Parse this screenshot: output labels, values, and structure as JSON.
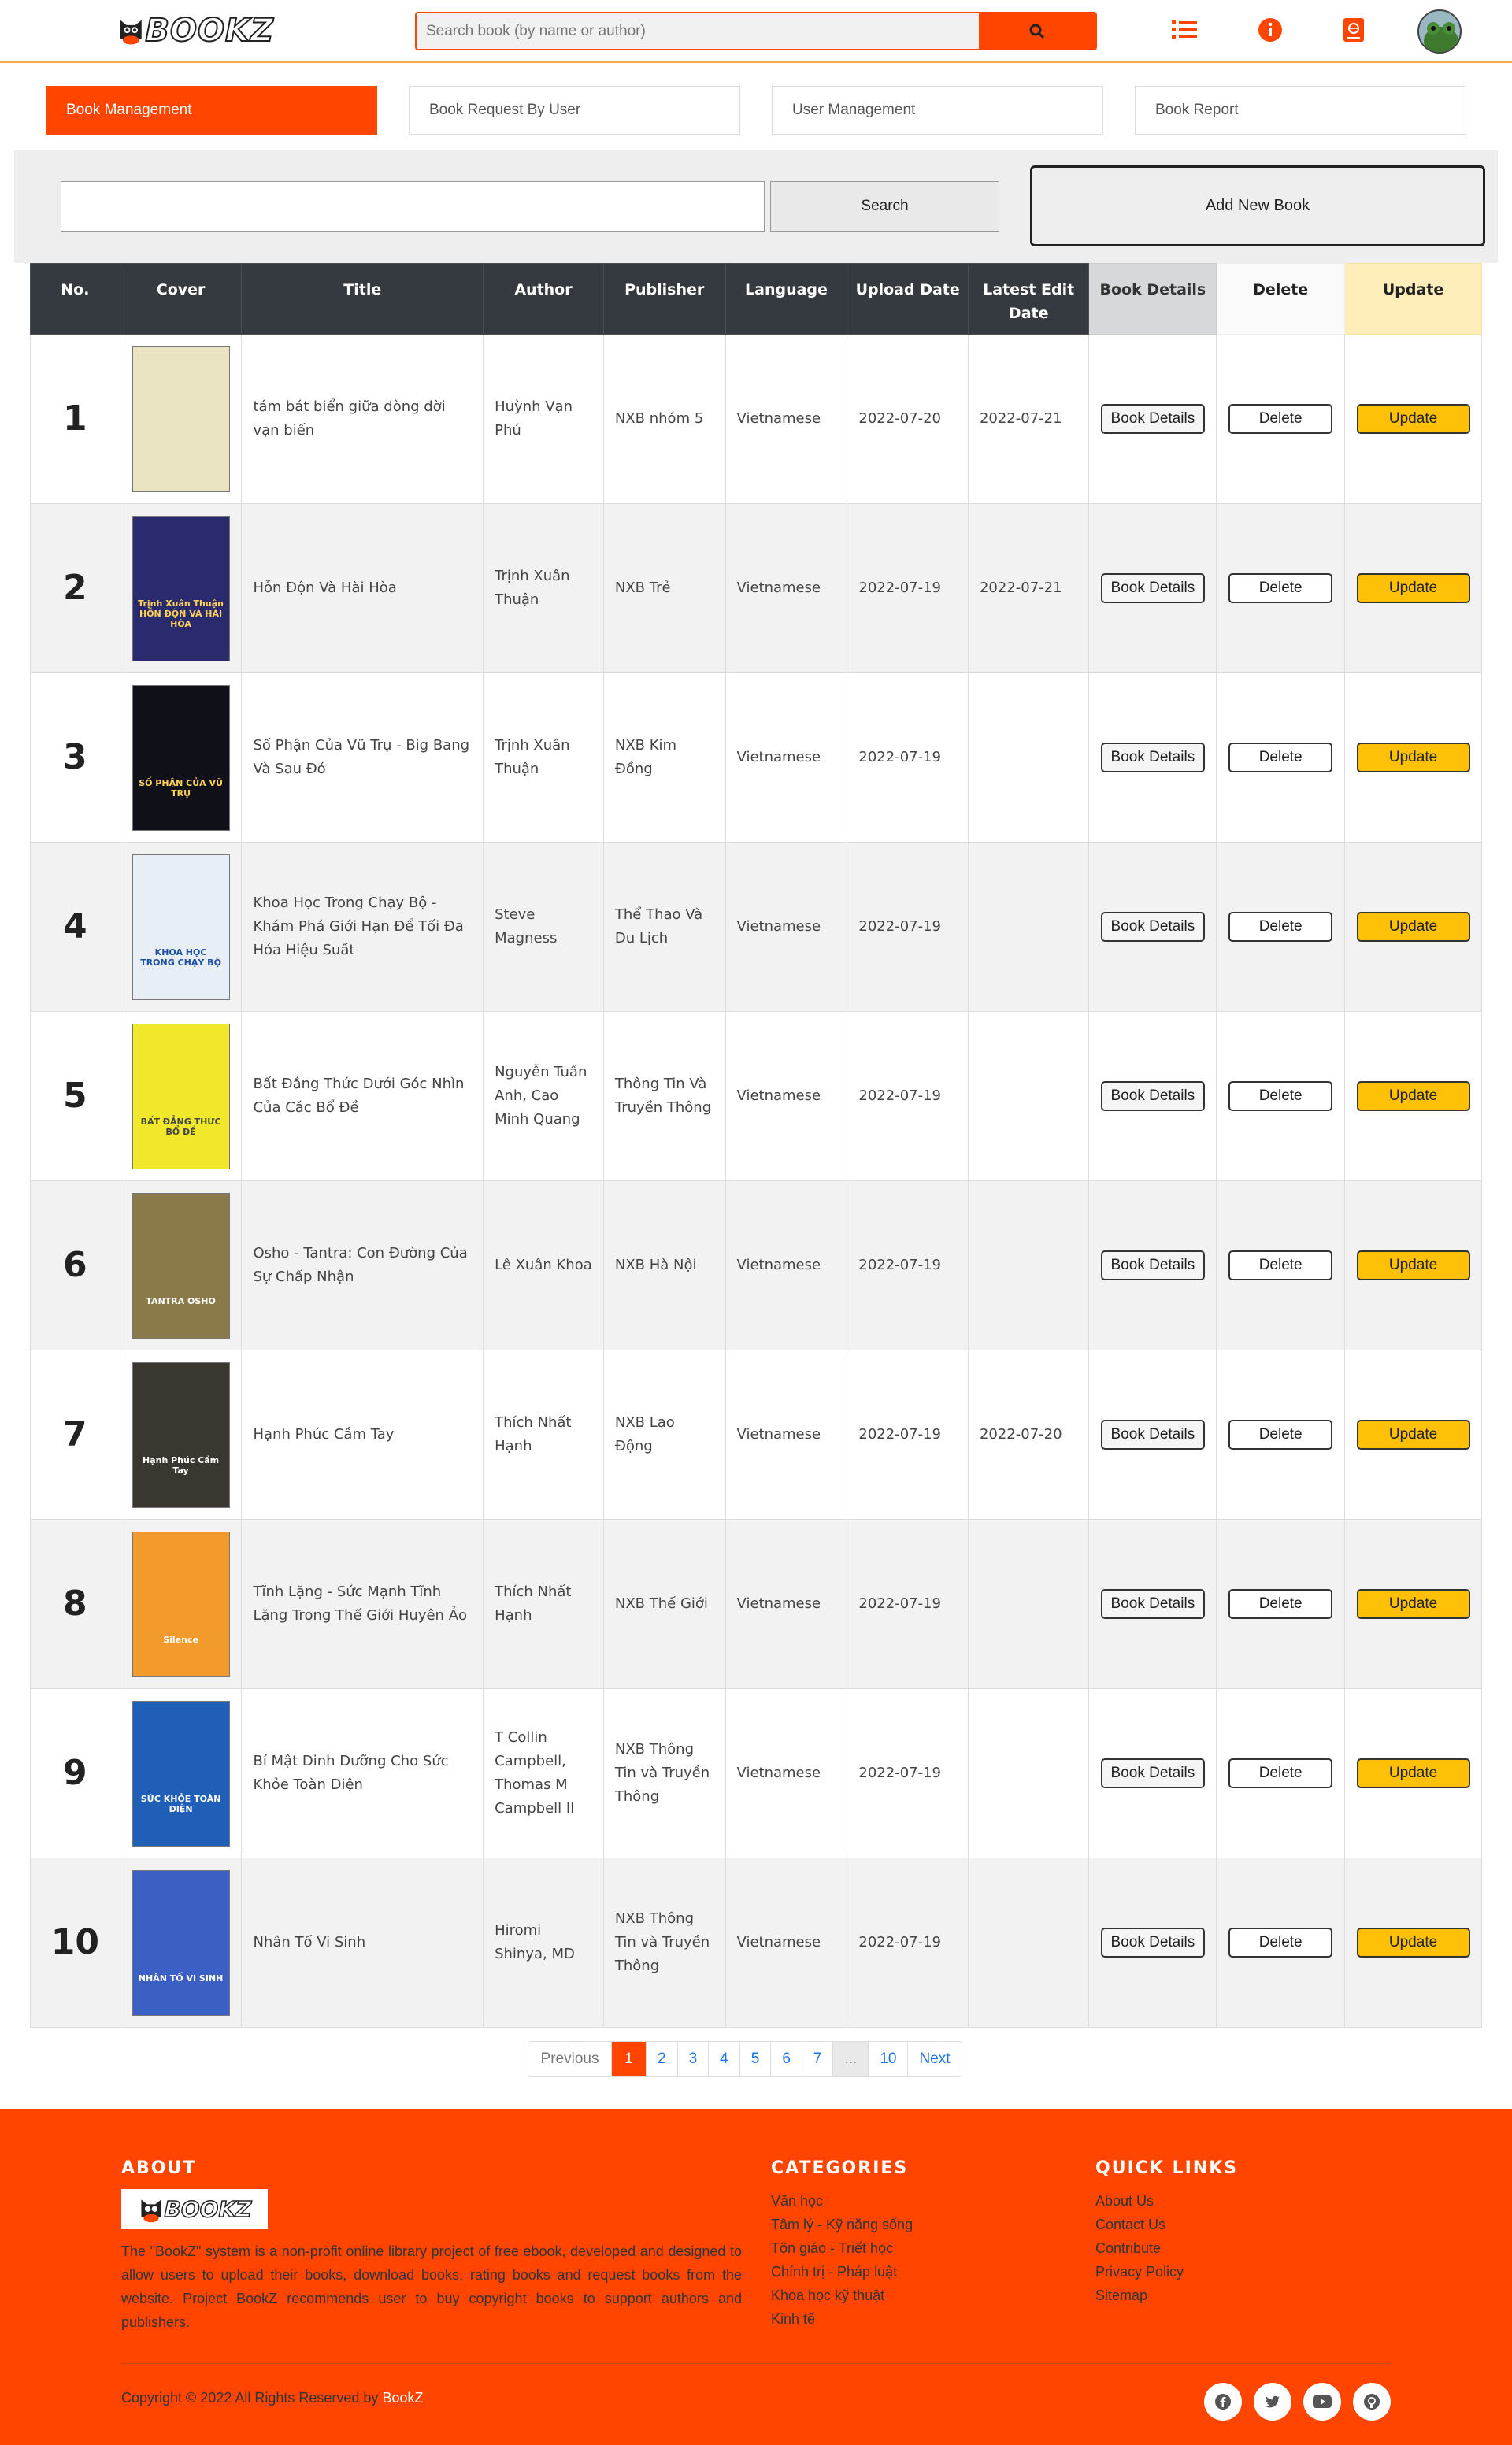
{
  "header": {
    "logo_text": "BOOKZ",
    "search_placeholder": "Search book (by name or author)",
    "icons": [
      "list-icon",
      "info-icon",
      "book-icon",
      "avatar"
    ]
  },
  "tabs": [
    {
      "label": "Book Management",
      "active": true
    },
    {
      "label": "Book Request By User",
      "active": false
    },
    {
      "label": "User Management",
      "active": false
    },
    {
      "label": "Book Report",
      "active": false
    }
  ],
  "toolbar": {
    "search_value": "",
    "search_label": "Search",
    "add_label": "Add New Book"
  },
  "table": {
    "headers": [
      "No.",
      "Cover",
      "Title",
      "Author",
      "Publisher",
      "Language",
      "Upload Date",
      "Latest Edit Date",
      "Book Details",
      "Delete",
      "Update"
    ],
    "button_labels": {
      "details": "Book Details",
      "delete": "Delete",
      "update": "Update"
    },
    "rows": [
      {
        "no": "1",
        "title": "tám bát biển giữa dòng đời vạn biến",
        "author": "Huỳnh Vạn Phú",
        "publisher": "NXB nhóm 5",
        "language": "Vietnamese",
        "upload": "2022-07-20",
        "edited": "2022-07-21",
        "cover_color": "#e9e3c2",
        "cover_text": "",
        "cover_text_color": "#333"
      },
      {
        "no": "2",
        "title": "Hỗn Độn Và Hài Hòa",
        "author": "Trịnh Xuân Thuận",
        "publisher": "NXB Trẻ",
        "language": "Vietnamese",
        "upload": "2022-07-19",
        "edited": "2022-07-21",
        "cover_color": "#2a2a6e",
        "cover_text": "Trịnh Xuân Thuận HỖN ĐỘN VÀ HÀI HÒA",
        "cover_text_color": "#ffd35a"
      },
      {
        "no": "3",
        "title": "Số Phận Của Vũ Trụ - Big Bang Và Sau Đó",
        "author": "Trịnh Xuân Thuận",
        "publisher": "NXB Kim Đồng",
        "language": "Vietnamese",
        "upload": "2022-07-19",
        "edited": "",
        "cover_color": "#101018",
        "cover_text": "SỐ PHẬN CỦA VŨ TRỤ",
        "cover_text_color": "#ffd35a"
      },
      {
        "no": "4",
        "title": "Khoa Học Trong Chạy Bộ - Khám Phá Giới Hạn Để Tối Đa Hóa Hiệu Suất",
        "author": "Steve Magness",
        "publisher": "Thể Thao Và Du Lịch",
        "language": "Vietnamese",
        "upload": "2022-07-19",
        "edited": "",
        "cover_color": "#e8eef5",
        "cover_text": "KHOA HỌC TRONG CHẠY BỘ",
        "cover_text_color": "#1d4fa0"
      },
      {
        "no": "5",
        "title": "Bất Đẳng Thức Dưới Góc Nhìn Của Các Bổ Đề",
        "author": "Nguyễn Tuấn Anh, Cao Minh Quang",
        "publisher": "Thông Tin Và Truyền Thông",
        "language": "Vietnamese",
        "upload": "2022-07-19",
        "edited": "",
        "cover_color": "#f2e82b",
        "cover_text": "BẤT ĐẲNG THỨC BỔ ĐỀ",
        "cover_text_color": "#444"
      },
      {
        "no": "6",
        "title": "Osho - Tantra: Con Đường Của Sự Chấp Nhận",
        "author": "Lê Xuân Khoa",
        "publisher": "NXB Hà Nội",
        "language": "Vietnamese",
        "upload": "2022-07-19",
        "edited": "",
        "cover_color": "#8a7a4a",
        "cover_text": "TANTRA OSHO",
        "cover_text_color": "#fff"
      },
      {
        "no": "7",
        "title": "Hạnh Phúc Cầm Tay",
        "author": "Thích Nhất Hạnh",
        "publisher": "NXB Lao Động",
        "language": "Vietnamese",
        "upload": "2022-07-19",
        "edited": "2022-07-20",
        "cover_color": "#3a3630",
        "cover_text": "Hạnh Phúc Cầm Tay",
        "cover_text_color": "#fff"
      },
      {
        "no": "8",
        "title": "Tĩnh Lặng - Sức Mạnh Tĩnh Lặng Trong Thế Giới Huyên Ảo",
        "author": "Thích Nhất Hạnh",
        "publisher": "NXB Thế Giới",
        "language": "Vietnamese",
        "upload": "2022-07-19",
        "edited": "",
        "cover_color": "#f39a2c",
        "cover_text": "Silence",
        "cover_text_color": "#fff"
      },
      {
        "no": "9",
        "title": "Bí Mật Dinh Dưỡng Cho Sức Khỏe Toàn Diện",
        "author": "T Collin Campbell, Thomas M Campbell II",
        "publisher": "NXB Thông Tin và Truyền Thông",
        "language": "Vietnamese",
        "upload": "2022-07-19",
        "edited": "",
        "cover_color": "#1f5fb8",
        "cover_text": "SỨC KHỎE TOÀN DIỆN",
        "cover_text_color": "#fff"
      },
      {
        "no": "10",
        "title": "Nhân Tố Vi Sinh",
        "author": "Hiromi Shinya, MD",
        "publisher": "NXB Thông Tin và Truyền Thông",
        "language": "Vietnamese",
        "upload": "2022-07-19",
        "edited": "",
        "cover_color": "#3b5fc4",
        "cover_text": "NHÂN TỐ VI SINH",
        "cover_text_color": "#fff"
      }
    ]
  },
  "pagination": {
    "prev": "Previous",
    "pages": [
      "1",
      "2",
      "3",
      "4",
      "5",
      "6",
      "7",
      "...",
      "10"
    ],
    "current": "1",
    "next": "Next"
  },
  "footer": {
    "about_title": "ABOUT",
    "about_text": "The \"BookZ\" system is a non-profit online library project of free ebook, developed and designed to allow users to upload their books, download books, rating books and request books from the website. Project BookZ recommends user to buy copyright books to support authors and publishers.",
    "categories_title": "CATEGORIES",
    "categories": [
      "Văn học",
      "Tâm lý - Kỹ năng sống",
      "Tôn giáo - Triết học",
      "Chính trị - Pháp luật",
      "Khoa học kỹ thuật",
      "Kinh tế"
    ],
    "quick_title": "QUICK LINKS",
    "quick_links": [
      "About Us",
      "Contact Us",
      "Contribute",
      "Privacy Policy",
      "Sitemap"
    ],
    "copyright": "Copyright © 2022 All Rights Reserved by ",
    "brand": "BookZ",
    "social": [
      "facebook-icon",
      "twitter-icon",
      "youtube-icon",
      "github-icon"
    ]
  },
  "colors": {
    "accent": "#ff4500",
    "update": "#ffc107",
    "header_dark": "#343a40"
  }
}
